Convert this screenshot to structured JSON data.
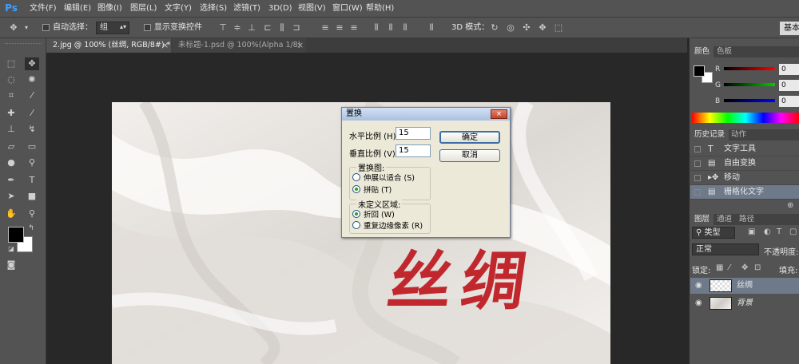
{
  "app": {
    "logo": "Ps"
  },
  "menu": [
    "文件(F)",
    "编辑(E)",
    "图像(I)",
    "图层(L)",
    "文字(Y)",
    "选择(S)",
    "滤镜(T)",
    "3D(D)",
    "视图(V)",
    "窗口(W)",
    "帮助(H)"
  ],
  "options": {
    "auto_select_label": "自动选择：",
    "auto_select_value": "组",
    "show_transform_label": "显示变换控件",
    "mode_3d_label": "3D 模式：",
    "workspace": "基本"
  },
  "tabs": [
    {
      "label": "2.jpg @ 100% (丝绸, RGB/8#) *",
      "close": "×"
    },
    {
      "label": "未标题-1.psd @ 100%(Alpha 1/8)",
      "close": "×"
    }
  ],
  "canvas": {
    "text": "丝绸",
    "text_color": "#c0282e"
  },
  "dialog": {
    "title": "置换",
    "close": "×",
    "h_scale_label": "水平比例 (H)",
    "h_scale_value": "15",
    "v_scale_label": "垂直比例 (V)",
    "v_scale_value": "15",
    "ok": "确定",
    "cancel": "取消",
    "map_group": "置换图:",
    "map_stretch": "伸展以适合 (S)",
    "map_tile": "拼贴 (T)",
    "undef_group": "未定义区域:",
    "undef_wrap": "折回 (W)",
    "undef_repeat": "重复边缘像素 (R)"
  },
  "color_panel": {
    "tabs": [
      "颜色",
      "色板"
    ],
    "sliders": [
      {
        "label": "R",
        "value": "0"
      },
      {
        "label": "G",
        "value": "0"
      },
      {
        "label": "B",
        "value": "0"
      }
    ]
  },
  "history_panel": {
    "tabs": [
      "历史记录",
      "动作"
    ],
    "items": [
      "文字工具",
      "自由变换",
      "移动",
      "栅格化文字"
    ]
  },
  "layers_panel": {
    "tabs": [
      "图层",
      "通道",
      "路径"
    ],
    "kind": "类型",
    "blend_mode": "正常",
    "opacity_label": "不透明度:",
    "lock_label": "锁定:",
    "fill_label": "填充:",
    "layers": [
      "丝绸",
      "背景"
    ]
  }
}
